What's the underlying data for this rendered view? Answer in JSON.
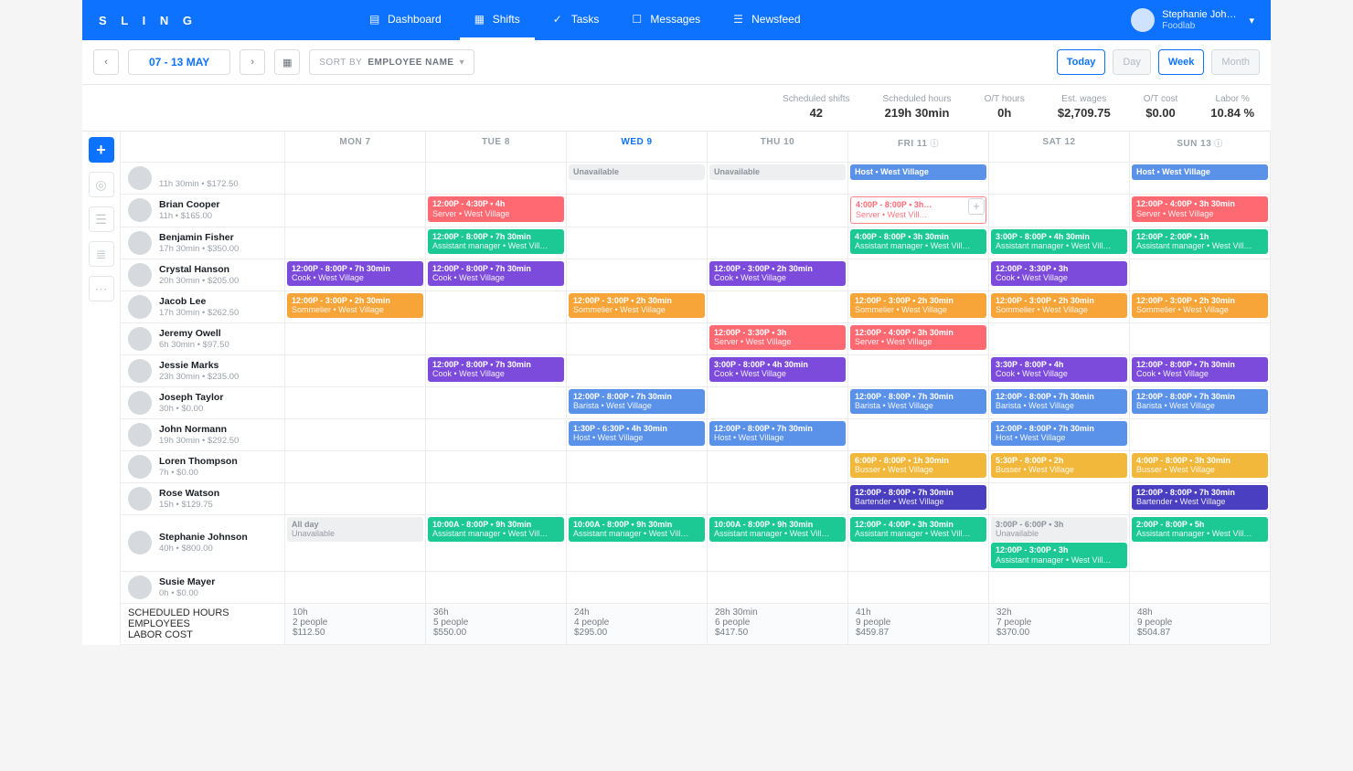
{
  "brand": "S L I N G",
  "nav": [
    {
      "label": "Dashboard",
      "active": false
    },
    {
      "label": "Shifts",
      "active": true
    },
    {
      "label": "Tasks",
      "active": false
    },
    {
      "label": "Messages",
      "active": false
    },
    {
      "label": "Newsfeed",
      "active": false
    }
  ],
  "profile": {
    "name": "Stephanie Joh…",
    "org": "Foodlab"
  },
  "toolbar": {
    "date_range": "07 - 13 MAY",
    "sort_label": "SORT BY",
    "sort_value": "EMPLOYEE NAME",
    "today": "Today",
    "views": [
      "Day",
      "Week",
      "Month"
    ],
    "active_view": "Week"
  },
  "summary": [
    {
      "label": "Scheduled shifts",
      "value": "42"
    },
    {
      "label": "Scheduled hours",
      "value": "219h 30min"
    },
    {
      "label": "O/T hours",
      "value": "0h"
    },
    {
      "label": "Est. wages",
      "value": "$2,709.75"
    },
    {
      "label": "O/T cost",
      "value": "$0.00"
    },
    {
      "label": "Labor %",
      "value": "10.84 %"
    }
  ],
  "days": [
    {
      "label": "MON 7",
      "active": false
    },
    {
      "label": "TUE 8",
      "active": false
    },
    {
      "label": "WED 9",
      "active": true
    },
    {
      "label": "THU 10",
      "active": false
    },
    {
      "label": "FRI 11",
      "active": false,
      "info": true
    },
    {
      "label": "SAT 12",
      "active": false
    },
    {
      "label": "SUN 13",
      "active": false,
      "info": true
    }
  ],
  "partial_row": {
    "name": "",
    "sub": "11h 30min • $172.50",
    "cells": [
      [],
      [],
      [
        {
          "cls": "unavail",
          "l1": "Unavailable",
          "l2": ""
        }
      ],
      [
        {
          "cls": "unavail",
          "l1": "Unavailable",
          "l2": ""
        }
      ],
      [
        {
          "cls": "blue",
          "l1": "Host • West Village",
          "l2": ""
        }
      ],
      [],
      [
        {
          "cls": "blue",
          "l1": "Host • West Village",
          "l2": ""
        }
      ]
    ]
  },
  "employees": [
    {
      "name": "Brian Cooper",
      "sub": "11h • $165.00",
      "cells": [
        [],
        [
          {
            "cls": "red",
            "l1": "12:00P - 4:30P • 4h",
            "l2": "Server • West Village"
          }
        ],
        [],
        [],
        [
          {
            "cls": "red-out",
            "l1": "4:00P - 8:00P • 3h…",
            "l2": "Server • West Vill…",
            "add": true
          }
        ],
        [],
        [
          {
            "cls": "red",
            "l1": "12:00P - 4:00P • 3h 30min",
            "l2": "Server • West Village"
          }
        ]
      ]
    },
    {
      "name": "Benjamin Fisher",
      "sub": "17h 30min • $350.00",
      "cells": [
        [],
        [
          {
            "cls": "teal",
            "l1": "12:00P - 8:00P • 7h 30min",
            "l2": "Assistant manager • West Vill…"
          }
        ],
        [],
        [],
        [
          {
            "cls": "teal",
            "l1": "4:00P - 8:00P • 3h 30min",
            "l2": "Assistant manager • West Vill…"
          }
        ],
        [
          {
            "cls": "teal",
            "l1": "3:00P - 8:00P • 4h 30min",
            "l2": "Assistant manager • West Vill…"
          }
        ],
        [
          {
            "cls": "teal",
            "l1": "12:00P - 2:00P • 1h",
            "l2": "Assistant manager • West Vill…"
          }
        ]
      ]
    },
    {
      "name": "Crystal Hanson",
      "sub": "20h 30min • $205.00",
      "cells": [
        [
          {
            "cls": "purple",
            "l1": "12:00P - 8:00P • 7h 30min",
            "l2": "Cook • West Village"
          }
        ],
        [
          {
            "cls": "purple",
            "l1": "12:00P - 8:00P • 7h 30min",
            "l2": "Cook • West Village"
          }
        ],
        [],
        [
          {
            "cls": "purple",
            "l1": "12:00P - 3:00P • 2h 30min",
            "l2": "Cook • West Village"
          }
        ],
        [],
        [
          {
            "cls": "purple",
            "l1": "12:00P - 3:30P • 3h",
            "l2": "Cook • West Village"
          }
        ],
        []
      ]
    },
    {
      "name": "Jacob Lee",
      "sub": "17h 30min • $262.50",
      "cells": [
        [
          {
            "cls": "orange",
            "l1": "12:00P - 3:00P • 2h 30min",
            "l2": "Sommelier • West Village"
          }
        ],
        [],
        [
          {
            "cls": "orange",
            "l1": "12:00P - 3:00P • 2h 30min",
            "l2": "Sommelier • West Village"
          }
        ],
        [],
        [
          {
            "cls": "orange",
            "l1": "12:00P - 3:00P • 2h 30min",
            "l2": "Sommelier • West Village"
          }
        ],
        [
          {
            "cls": "orange",
            "l1": "12:00P - 3:00P • 2h 30min",
            "l2": "Sommelier • West Village"
          }
        ],
        [
          {
            "cls": "orange",
            "l1": "12:00P - 3:00P • 2h 30min",
            "l2": "Sommelier • West Village"
          }
        ]
      ]
    },
    {
      "name": "Jeremy Owell",
      "sub": "6h 30min • $97.50",
      "cells": [
        [],
        [],
        [],
        [
          {
            "cls": "red",
            "l1": "12:00P - 3:30P • 3h",
            "l2": "Server • West Village"
          }
        ],
        [
          {
            "cls": "red",
            "l1": "12:00P - 4:00P • 3h 30min",
            "l2": "Server • West Village"
          }
        ],
        [],
        []
      ]
    },
    {
      "name": "Jessie Marks",
      "sub": "23h 30min • $235.00",
      "cells": [
        [],
        [
          {
            "cls": "purple",
            "l1": "12:00P - 8:00P • 7h 30min",
            "l2": "Cook • West Village"
          }
        ],
        [],
        [
          {
            "cls": "purple",
            "l1": "3:00P - 8:00P • 4h 30min",
            "l2": "Cook • West Village"
          }
        ],
        [],
        [
          {
            "cls": "purple",
            "l1": "3:30P - 8:00P • 4h",
            "l2": "Cook • West Village"
          }
        ],
        [
          {
            "cls": "purple",
            "l1": "12:00P - 8:00P • 7h 30min",
            "l2": "Cook • West Village"
          }
        ]
      ]
    },
    {
      "name": "Joseph Taylor",
      "sub": "30h • $0.00",
      "cells": [
        [],
        [],
        [
          {
            "cls": "blue",
            "l1": "12:00P - 8:00P • 7h 30min",
            "l2": "Barista • West Village"
          }
        ],
        [],
        [
          {
            "cls": "blue",
            "l1": "12:00P - 8:00P • 7h 30min",
            "l2": "Barista • West Village"
          }
        ],
        [
          {
            "cls": "blue",
            "l1": "12:00P - 8:00P • 7h 30min",
            "l2": "Barista • West Village"
          }
        ],
        [
          {
            "cls": "blue",
            "l1": "12:00P - 8:00P • 7h 30min",
            "l2": "Barista • West Village"
          }
        ]
      ]
    },
    {
      "name": "John Normann",
      "sub": "19h 30min • $292.50",
      "cells": [
        [],
        [],
        [
          {
            "cls": "blue",
            "l1": "1:30P - 6:30P • 4h 30min",
            "l2": "Host • West Village"
          }
        ],
        [
          {
            "cls": "blue",
            "l1": "12:00P - 8:00P • 7h 30min",
            "l2": "Host • West Village"
          }
        ],
        [],
        [
          {
            "cls": "blue",
            "l1": "12:00P - 8:00P • 7h 30min",
            "l2": "Host • West Village"
          }
        ],
        []
      ]
    },
    {
      "name": "Loren Thompson",
      "sub": "7h • $0.00",
      "cells": [
        [],
        [],
        [],
        [],
        [
          {
            "cls": "gold",
            "l1": "6:00P - 8:00P • 1h 30min",
            "l2": "Busser • West Village"
          }
        ],
        [
          {
            "cls": "gold",
            "l1": "5:30P - 8:00P • 2h",
            "l2": "Busser • West Village"
          }
        ],
        [
          {
            "cls": "gold",
            "l1": "4:00P - 8:00P • 3h 30min",
            "l2": "Busser • West Village"
          }
        ]
      ]
    },
    {
      "name": "Rose Watson",
      "sub": "15h • $129.75",
      "cells": [
        [],
        [],
        [],
        [],
        [
          {
            "cls": "indigo",
            "l1": "12:00P - 8:00P • 7h 30min",
            "l2": "Bartender • West Village"
          }
        ],
        [],
        [
          {
            "cls": "indigo",
            "l1": "12:00P - 8:00P • 7h 30min",
            "l2": "Bartender • West Village"
          }
        ]
      ]
    },
    {
      "name": "Stephanie Johnson",
      "sub": "40h • $800.00",
      "cells": [
        [
          {
            "cls": "unavail",
            "l1": "All day",
            "l2": "Unavailable"
          }
        ],
        [
          {
            "cls": "teal",
            "l1": "10:00A - 8:00P • 9h 30min",
            "l2": "Assistant manager • West Vill…"
          }
        ],
        [
          {
            "cls": "teal",
            "l1": "10:00A - 8:00P • 9h 30min",
            "l2": "Assistant manager • West Vill…"
          }
        ],
        [
          {
            "cls": "teal",
            "l1": "10:00A - 8:00P • 9h 30min",
            "l2": "Assistant manager • West Vill…"
          }
        ],
        [
          {
            "cls": "teal",
            "l1": "12:00P - 4:00P • 3h 30min",
            "l2": "Assistant manager • West Vill…"
          }
        ],
        [
          {
            "cls": "unavail",
            "l1": "3:00P - 6:00P • 3h",
            "l2": "Unavailable"
          },
          {
            "cls": "teal",
            "l1": "12:00P - 3:00P • 3h",
            "l2": "Assistant manager • West Vill…"
          }
        ],
        [
          {
            "cls": "teal",
            "l1": "2:00P - 8:00P • 5h",
            "l2": "Assistant manager • West Vill…"
          }
        ]
      ]
    },
    {
      "name": "Susie Mayer",
      "sub": "0h • $0.00",
      "cells": [
        [],
        [],
        [],
        [],
        [],
        [],
        []
      ]
    }
  ],
  "footer": {
    "labels": [
      "SCHEDULED HOURS",
      "EMPLOYEES",
      "LABOR COST"
    ],
    "cols": [
      [
        "10h",
        "2 people",
        "$112.50"
      ],
      [
        "36h",
        "5 people",
        "$550.00"
      ],
      [
        "24h",
        "4 people",
        "$295.00"
      ],
      [
        "28h 30min",
        "6 people",
        "$417.50"
      ],
      [
        "41h",
        "9 people",
        "$459.87"
      ],
      [
        "32h",
        "7 people",
        "$370.00"
      ],
      [
        "48h",
        "9 people",
        "$504.87"
      ]
    ]
  }
}
